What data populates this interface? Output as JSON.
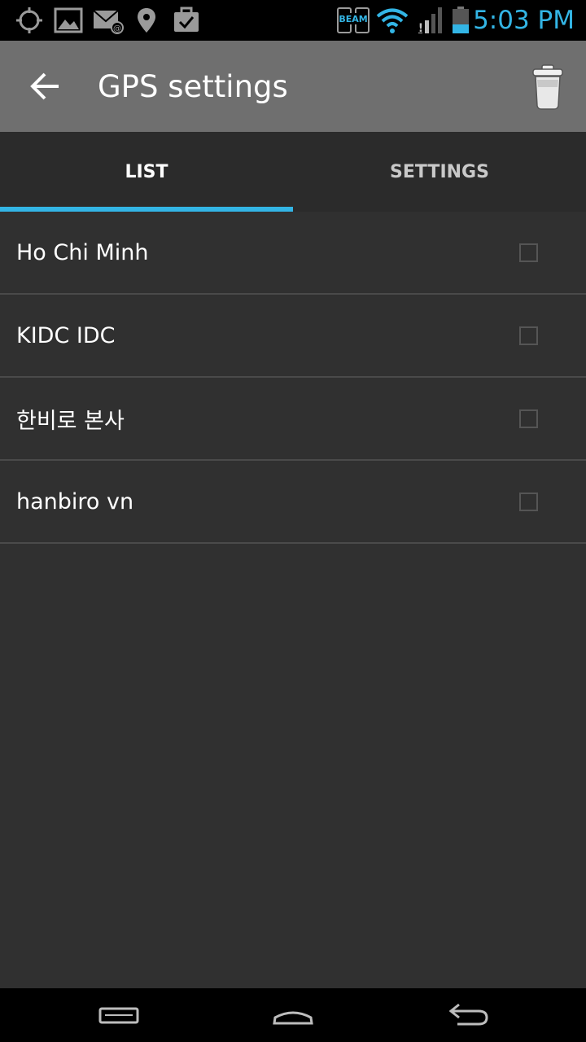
{
  "status_bar": {
    "time": "5:03 PM",
    "left_icons": [
      "gps-icon",
      "image-icon",
      "email-icon",
      "location-pin-icon",
      "task-icon"
    ],
    "right_icons": [
      "beam-icon",
      "wifi-icon",
      "signal-icon",
      "battery-icon"
    ],
    "beam_label": "BEAM",
    "accent_color": "#33b5e5"
  },
  "action_bar": {
    "title": "GPS settings",
    "back_icon": "arrow-back-icon",
    "action_icon": "trash-icon"
  },
  "tabs": [
    {
      "label": "LIST",
      "selected": true
    },
    {
      "label": "SETTINGS",
      "selected": false
    }
  ],
  "list": {
    "items": [
      {
        "label": "Ho Chi Minh",
        "checked": false
      },
      {
        "label": "KIDC IDC",
        "checked": false
      },
      {
        "label": "한비로 본사",
        "checked": false
      },
      {
        "label": "hanbiro vn",
        "checked": false
      }
    ]
  },
  "nav_bar": {
    "icons": [
      "recent-apps-icon",
      "home-icon",
      "back-icon"
    ]
  }
}
